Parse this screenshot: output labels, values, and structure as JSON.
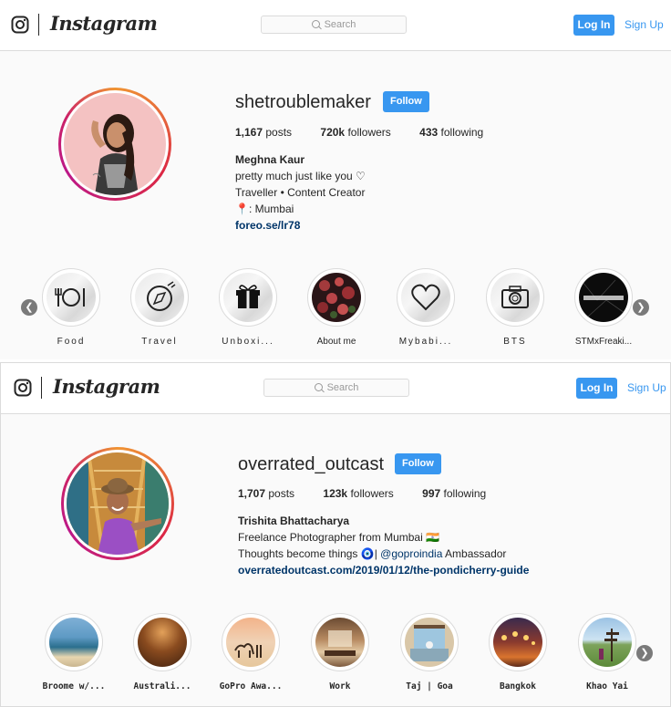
{
  "top": {
    "nav": {
      "wordmark": "Instagram",
      "search_placeholder": "Search",
      "login": "Log In",
      "signup": "Sign Up"
    },
    "profile": {
      "username": "shetroublemaker",
      "follow": "Follow",
      "posts_count": "1,167",
      "posts_label": "posts",
      "followers_count": "720k",
      "followers_label": "followers",
      "following_count": "433",
      "following_label": "following",
      "name": "Meghna Kaur",
      "bio": [
        "pretty much just like you ♡",
        "Traveller • Content Creator",
        "📍: Mumbai"
      ],
      "link": "foreo.se/lr78"
    },
    "highlights": [
      {
        "label": "Food",
        "icon": "plate-cutlery-icon"
      },
      {
        "label": "Travel",
        "icon": "compass-icon"
      },
      {
        "label": "Unboxi...",
        "icon": "gift-icon"
      },
      {
        "label": "About me",
        "icon": "flowers-photo"
      },
      {
        "label": "Mybabi...",
        "icon": "heart-icon"
      },
      {
        "label": "BTS",
        "icon": "camera-icon"
      },
      {
        "label": "STMxFreaki...",
        "icon": "text-photo"
      }
    ]
  },
  "bottom": {
    "nav": {
      "wordmark": "Instagram",
      "search_placeholder": "Search",
      "login": "Log In",
      "signup": "Sign Up"
    },
    "profile": {
      "username": "overrated_outcast",
      "follow": "Follow",
      "posts_count": "1,707",
      "posts_label": "posts",
      "followers_count": "123k",
      "followers_label": "followers",
      "following_count": "997",
      "following_label": "following",
      "name": "Trishita Bhattacharya",
      "bio_line1": "Freelance Photographer from Mumbai 🇮🇳",
      "bio_line2_pre": "Thoughts become things 🧿| ",
      "bio_line2_mention": "@goproindia",
      "bio_line2_post": " Ambassador",
      "link": "overratedoutcast.com/2019/01/12/the-pondicherry-guide"
    },
    "highlights": [
      {
        "label": "Broome w/..."
      },
      {
        "label": "Australi..."
      },
      {
        "label": "GoPro Awa..."
      },
      {
        "label": "Work"
      },
      {
        "label": "Taj | Goa"
      },
      {
        "label": "Bangkok"
      },
      {
        "label": "Khao Yai"
      }
    ]
  },
  "colors": {
    "accent": "#3897f0",
    "link": "#003569",
    "text": "#262626"
  }
}
